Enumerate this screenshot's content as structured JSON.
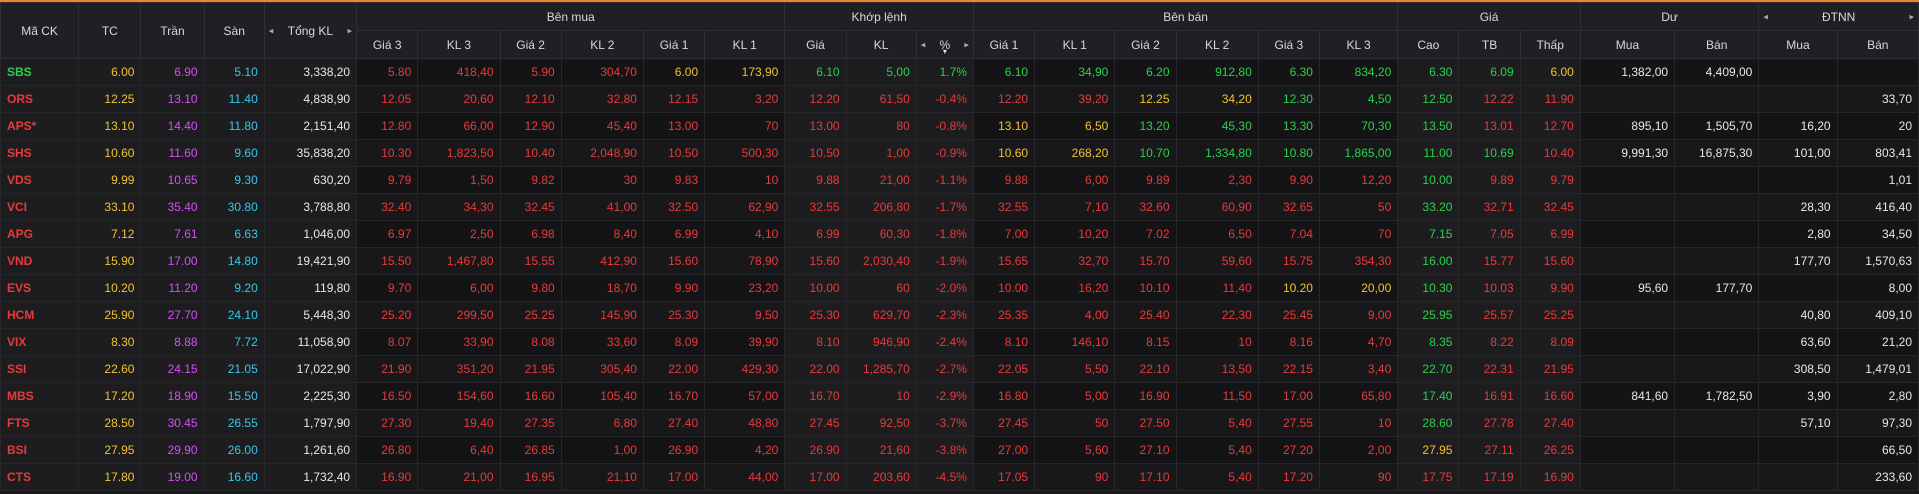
{
  "header": {
    "symbol": "Mã CK",
    "tc": "TC",
    "ceil": "Trần",
    "floor": "Sàn",
    "total_vol": "Tổng KL",
    "buy_side": "Bên mua",
    "match": "Khớp lệnh",
    "sell_side": "Bên bán",
    "price": "Giá",
    "remain": "Dư",
    "foreign": "ĐTNN",
    "gia3": "Giá 3",
    "kl3": "KL 3",
    "gia2": "Giá 2",
    "kl2": "KL 2",
    "gia1": "Giá 1",
    "kl1": "KL 1",
    "gia": "Giá",
    "kl": "KL",
    "pct": "%",
    "high": "Cao",
    "avg": "TB",
    "low": "Thấp",
    "mua": "Mua",
    "ban": "Bán",
    "left_arrow": "◂",
    "right_arrow": "▸",
    "sort_arrow": "▾"
  },
  "colors": {
    "up": "#2bd14a",
    "down": "#e83a3a",
    "ref": "#f2c32f",
    "ceiling": "#d44ff2",
    "floor": "#35c8e8",
    "accent": "#e8862a"
  },
  "rows": [
    {
      "sym": "SBS",
      "tc": "6.00",
      "tran": "6.90",
      "san": "5.10",
      "tkl": "3,338,20",
      "b3": "5.80",
      "b3v": "418,40",
      "b2": "5.90",
      "b2v": "304,70",
      "b1": "6.00",
      "b1v": "173,90",
      "mp": "6.10",
      "mv": "5,00",
      "pct": "1.7%",
      "s1": "6.10",
      "s1v": "34,90",
      "s2": "6.20",
      "s2v": "912,80",
      "s3": "6.30",
      "s3v": "834,20",
      "hi": "6.30",
      "avg": "6.09",
      "lo": "6.00",
      "rbuy": "1,382,00",
      "rsell": "4,409,00",
      "fbuy": "",
      "fsell": ""
    },
    {
      "sym": "ORS",
      "tc": "12.25",
      "tran": "13.10",
      "san": "11.40",
      "tkl": "4,838,90",
      "b3": "12.05",
      "b3v": "20,60",
      "b2": "12.10",
      "b2v": "32,80",
      "b1": "12.15",
      "b1v": "3,20",
      "mp": "12.20",
      "mv": "61,50",
      "pct": "-0.4%",
      "s1": "12.20",
      "s1v": "39,20",
      "s2": "12.25",
      "s2v": "34,20",
      "s3": "12.30",
      "s3v": "4,50",
      "hi": "12.50",
      "avg": "12.22",
      "lo": "11.90",
      "rbuy": "",
      "rsell": "",
      "fbuy": "",
      "fsell": "33,70"
    },
    {
      "sym": "APS*",
      "tc": "13.10",
      "tran": "14.40",
      "san": "11.80",
      "tkl": "2,151,40",
      "b3": "12.80",
      "b3v": "66,00",
      "b2": "12.90",
      "b2v": "45,40",
      "b1": "13.00",
      "b1v": "70",
      "mp": "13.00",
      "mv": "80",
      "pct": "-0.8%",
      "s1": "13.10",
      "s1v": "6,50",
      "s2": "13.20",
      "s2v": "45,30",
      "s3": "13.30",
      "s3v": "70,30",
      "hi": "13.50",
      "avg": "13.01",
      "lo": "12.70",
      "rbuy": "895,10",
      "rsell": "1,505,70",
      "fbuy": "16,20",
      "fsell": "20"
    },
    {
      "sym": "SHS",
      "tc": "10.60",
      "tran": "11.60",
      "san": "9.60",
      "tkl": "35,838,20",
      "b3": "10.30",
      "b3v": "1,823,50",
      "b2": "10.40",
      "b2v": "2,048,90",
      "b1": "10.50",
      "b1v": "500,30",
      "mp": "10.50",
      "mv": "1,00",
      "pct": "-0.9%",
      "s1": "10.60",
      "s1v": "268,20",
      "s2": "10.70",
      "s2v": "1,334,80",
      "s3": "10.80",
      "s3v": "1,865,00",
      "hi": "11.00",
      "avg": "10.69",
      "lo": "10.40",
      "rbuy": "9,991,30",
      "rsell": "16,875,30",
      "fbuy": "101,00",
      "fsell": "803,41"
    },
    {
      "sym": "VDS",
      "tc": "9.99",
      "tran": "10.65",
      "san": "9.30",
      "tkl": "630,20",
      "b3": "9.79",
      "b3v": "1,50",
      "b2": "9.82",
      "b2v": "30",
      "b1": "9.83",
      "b1v": "10",
      "mp": "9.88",
      "mv": "21,00",
      "pct": "-1.1%",
      "s1": "9.88",
      "s1v": "6,00",
      "s2": "9.89",
      "s2v": "2,30",
      "s3": "9.90",
      "s3v": "12,20",
      "hi": "10.00",
      "avg": "9.89",
      "lo": "9.79",
      "rbuy": "",
      "rsell": "",
      "fbuy": "",
      "fsell": "1,01"
    },
    {
      "sym": "VCI",
      "tc": "33.10",
      "tran": "35.40",
      "san": "30.80",
      "tkl": "3,788,80",
      "b3": "32.40",
      "b3v": "34,30",
      "b2": "32.45",
      "b2v": "41,00",
      "b1": "32.50",
      "b1v": "62,90",
      "mp": "32.55",
      "mv": "206,80",
      "pct": "-1.7%",
      "s1": "32.55",
      "s1v": "7,10",
      "s2": "32.60",
      "s2v": "60,90",
      "s3": "32.65",
      "s3v": "50",
      "hi": "33.20",
      "avg": "32.71",
      "lo": "32.45",
      "rbuy": "",
      "rsell": "",
      "fbuy": "28,30",
      "fsell": "416,40"
    },
    {
      "sym": "APG",
      "tc": "7.12",
      "tran": "7.61",
      "san": "6.63",
      "tkl": "1,046,00",
      "b3": "6.97",
      "b3v": "2,50",
      "b2": "6.98",
      "b2v": "8,40",
      "b1": "6.99",
      "b1v": "4,10",
      "mp": "6.99",
      "mv": "60,30",
      "pct": "-1.8%",
      "s1": "7.00",
      "s1v": "10,20",
      "s2": "7.02",
      "s2v": "6,50",
      "s3": "7.04",
      "s3v": "70",
      "hi": "7.15",
      "avg": "7.05",
      "lo": "6.99",
      "rbuy": "",
      "rsell": "",
      "fbuy": "2,80",
      "fsell": "34,50"
    },
    {
      "sym": "VND",
      "tc": "15.90",
      "tran": "17.00",
      "san": "14.80",
      "tkl": "19,421,90",
      "b3": "15.50",
      "b3v": "1,467,80",
      "b2": "15.55",
      "b2v": "412,90",
      "b1": "15.60",
      "b1v": "78,90",
      "mp": "15.60",
      "mv": "2,030,40",
      "pct": "-1.9%",
      "s1": "15.65",
      "s1v": "32,70",
      "s2": "15.70",
      "s2v": "59,60",
      "s3": "15.75",
      "s3v": "354,30",
      "hi": "16.00",
      "avg": "15.77",
      "lo": "15.60",
      "rbuy": "",
      "rsell": "",
      "fbuy": "177,70",
      "fsell": "1,570,63"
    },
    {
      "sym": "EVS",
      "tc": "10.20",
      "tran": "11.20",
      "san": "9.20",
      "tkl": "119,80",
      "b3": "9.70",
      "b3v": "6,00",
      "b2": "9.80",
      "b2v": "18,70",
      "b1": "9.90",
      "b1v": "23,20",
      "mp": "10.00",
      "mv": "60",
      "pct": "-2.0%",
      "s1": "10.00",
      "s1v": "16,20",
      "s2": "10.10",
      "s2v": "11,40",
      "s3": "10.20",
      "s3v": "20,00",
      "hi": "10.30",
      "avg": "10.03",
      "lo": "9.90",
      "rbuy": "95,60",
      "rsell": "177,70",
      "fbuy": "",
      "fsell": "8,00"
    },
    {
      "sym": "HCM",
      "tc": "25.90",
      "tran": "27.70",
      "san": "24.10",
      "tkl": "5,448,30",
      "b3": "25.20",
      "b3v": "299,50",
      "b2": "25.25",
      "b2v": "145,90",
      "b1": "25.30",
      "b1v": "9,50",
      "mp": "25.30",
      "mv": "629,70",
      "pct": "-2.3%",
      "s1": "25.35",
      "s1v": "4,00",
      "s2": "25.40",
      "s2v": "22,30",
      "s3": "25.45",
      "s3v": "9,00",
      "hi": "25.95",
      "avg": "25.57",
      "lo": "25.25",
      "rbuy": "",
      "rsell": "",
      "fbuy": "40,80",
      "fsell": "409,10"
    },
    {
      "sym": "VIX",
      "tc": "8.30",
      "tran": "8.88",
      "san": "7.72",
      "tkl": "11,058,90",
      "b3": "8.07",
      "b3v": "33,90",
      "b2": "8.08",
      "b2v": "33,60",
      "b1": "8.09",
      "b1v": "39,90",
      "mp": "8.10",
      "mv": "946,90",
      "pct": "-2.4%",
      "s1": "8.10",
      "s1v": "146,10",
      "s2": "8.15",
      "s2v": "10",
      "s3": "8.16",
      "s3v": "4,70",
      "hi": "8.35",
      "avg": "8.22",
      "lo": "8.09",
      "rbuy": "",
      "rsell": "",
      "fbuy": "63,60",
      "fsell": "21,20"
    },
    {
      "sym": "SSI",
      "tc": "22.60",
      "tran": "24.15",
      "san": "21.05",
      "tkl": "17,022,90",
      "b3": "21.90",
      "b3v": "351,20",
      "b2": "21.95",
      "b2v": "305,40",
      "b1": "22.00",
      "b1v": "429,30",
      "mp": "22.00",
      "mv": "1,285,70",
      "pct": "-2.7%",
      "s1": "22.05",
      "s1v": "5,50",
      "s2": "22.10",
      "s2v": "13,50",
      "s3": "22.15",
      "s3v": "3,40",
      "hi": "22.70",
      "avg": "22.31",
      "lo": "21.95",
      "rbuy": "",
      "rsell": "",
      "fbuy": "308,50",
      "fsell": "1,479,01"
    },
    {
      "sym": "MBS",
      "tc": "17.20",
      "tran": "18.90",
      "san": "15.50",
      "tkl": "2,225,30",
      "b3": "16.50",
      "b3v": "154,60",
      "b2": "16.60",
      "b2v": "105,40",
      "b1": "16.70",
      "b1v": "57,00",
      "mp": "16.70",
      "mv": "10",
      "pct": "-2.9%",
      "s1": "16.80",
      "s1v": "5,00",
      "s2": "16.90",
      "s2v": "11,50",
      "s3": "17.00",
      "s3v": "65,80",
      "hi": "17.40",
      "avg": "16.91",
      "lo": "16.60",
      "rbuy": "841,60",
      "rsell": "1,782,50",
      "fbuy": "3,90",
      "fsell": "2,80"
    },
    {
      "sym": "FTS",
      "tc": "28.50",
      "tran": "30.45",
      "san": "26.55",
      "tkl": "1,797,90",
      "b3": "27.30",
      "b3v": "19,40",
      "b2": "27.35",
      "b2v": "6,80",
      "b1": "27.40",
      "b1v": "48,80",
      "mp": "27.45",
      "mv": "92,50",
      "pct": "-3.7%",
      "s1": "27.45",
      "s1v": "50",
      "s2": "27.50",
      "s2v": "5,40",
      "s3": "27.55",
      "s3v": "10",
      "hi": "28.60",
      "avg": "27.78",
      "lo": "27.40",
      "rbuy": "",
      "rsell": "",
      "fbuy": "57,10",
      "fsell": "97,30"
    },
    {
      "sym": "BSI",
      "tc": "27.95",
      "tran": "29.90",
      "san": "26.00",
      "tkl": "1,261,60",
      "b3": "26.80",
      "b3v": "6,40",
      "b2": "26.85",
      "b2v": "1,00",
      "b1": "26.90",
      "b1v": "4,20",
      "mp": "26.90",
      "mv": "21,60",
      "pct": "-3.8%",
      "s1": "27.00",
      "s1v": "5,60",
      "s2": "27.10",
      "s2v": "5,40",
      "s3": "27.20",
      "s3v": "2,00",
      "hi": "27.95",
      "avg": "27.11",
      "lo": "26.25",
      "rbuy": "",
      "rsell": "",
      "fbuy": "",
      "fsell": "66,50"
    },
    {
      "sym": "CTS",
      "tc": "17.80",
      "tran": "19.00",
      "san": "16.60",
      "tkl": "1,732,40",
      "b3": "16.90",
      "b3v": "21,00",
      "b2": "16.95",
      "b2v": "21,10",
      "b1": "17.00",
      "b1v": "44,00",
      "mp": "17.00",
      "mv": "203,60",
      "pct": "-4.5%",
      "s1": "17.05",
      "s1v": "90",
      "s2": "17.10",
      "s2v": "5,40",
      "s3": "17.20",
      "s3v": "90",
      "hi": "17.75",
      "avg": "17.19",
      "lo": "16.90",
      "rbuy": "",
      "rsell": "",
      "fbuy": "",
      "fsell": "233,60"
    }
  ]
}
